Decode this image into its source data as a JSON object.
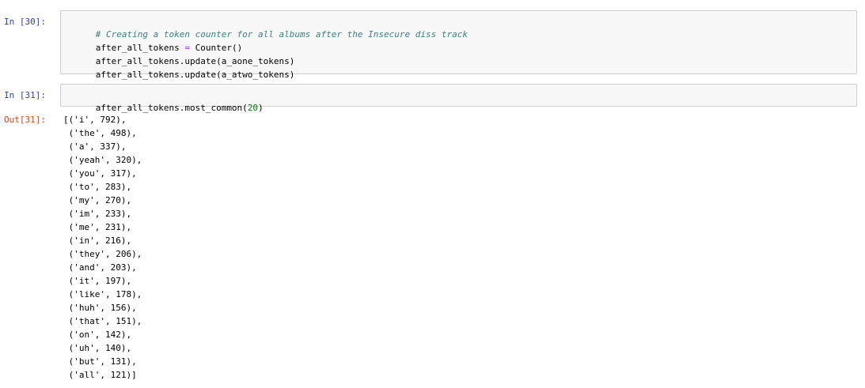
{
  "cells": [
    {
      "prompt": "In [30]:",
      "code": [
        [
          {
            "t": "# Creating a token counter for all albums after the Insecure diss track",
            "c": "comment"
          }
        ],
        [
          {
            "t": "after_all_tokens ",
            "c": "name"
          },
          {
            "t": "=",
            "c": "op"
          },
          {
            "t": " Counter()",
            "c": "name"
          }
        ],
        [
          {
            "t": "after_all_tokens.update(a_aone_tokens)",
            "c": "name"
          }
        ],
        [
          {
            "t": "after_all_tokens.update(a_atwo_tokens)",
            "c": "name"
          }
        ]
      ]
    },
    {
      "prompt": "In [31]:",
      "code": [
        [
          {
            "t": "after_all_tokens.most_common(",
            "c": "name"
          },
          {
            "t": "20",
            "c": "num"
          },
          {
            "t": ")",
            "c": "name"
          }
        ]
      ]
    }
  ],
  "output": {
    "prompt": "Out[31]:",
    "lines": [
      "[('i', 792),",
      " ('the', 498),",
      " ('a', 337),",
      " ('yeah', 320),",
      " ('you', 317),",
      " ('to', 283),",
      " ('my', 270),",
      " ('im', 233),",
      " ('me', 231),",
      " ('in', 216),",
      " ('they', 206),",
      " ('and', 203),",
      " ('it', 197),",
      " ('like', 178),",
      " ('huh', 156),",
      " ('that', 151),",
      " ('on', 142),",
      " ('uh', 140),",
      " ('but', 131),",
      " ('all', 121)]"
    ]
  },
  "colors": {
    "in_prompt": "#303f9f",
    "out_prompt": "#d84315",
    "comment": "#408080",
    "operator": "#aa22ff",
    "number": "#008000",
    "cell_bg": "#f7f7f7",
    "cell_border": "#cfcfcf"
  }
}
